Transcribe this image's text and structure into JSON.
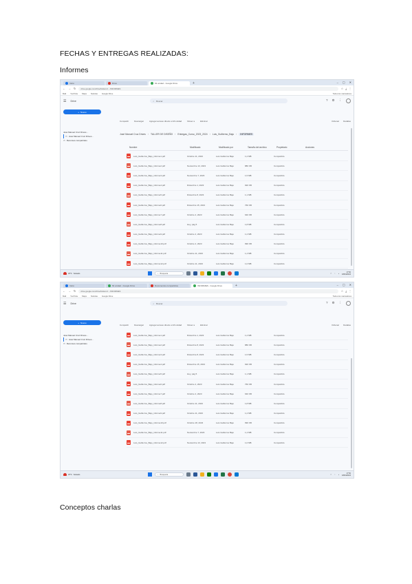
{
  "document": {
    "heading_fechas": "FECHAS Y ENTREGAS REALIZADAS:",
    "heading_informes": "Informes",
    "heading_conceptos": "Conceptos charlas"
  },
  "colors": {
    "accent": "#1a73e8",
    "pdf_red": "#e94335",
    "taskbar": "#e9eef5"
  },
  "screenshot_1": {
    "tabs": [
      "Inicio",
      "Drive",
      "Mi unidad - Google Drive"
    ],
    "url": "drive.google.com/drive/folders/1…/INFORMES",
    "bookmarks": [
      "Mail",
      "YouTube",
      "Maps",
      "Noticias",
      "Google Drive"
    ],
    "bookmarks_right": "Todos los marcadores",
    "drive_logo": "Drive",
    "search_placeholder": "Buscar",
    "new_button": "Nuevo",
    "side_items": [
      "José Manuel Cruz Drives…",
      "José Manuel Cruz Drives…",
      "Recursos compartidos"
    ],
    "toolbar": [
      "Compartir",
      "Descargar",
      "Agregar acceso directo a Mi unidad",
      "Mover a",
      "Eliminar"
    ],
    "toolbar_right": [
      "Ordenar",
      "Detalles"
    ],
    "breadcrumbs": [
      "José Manuel Cruz Drives",
      "TALLER DE DISEÑO",
      "Entregas_Curso_2023_2024",
      "Luis_Guillermo_Bajo",
      "INFORMES"
    ],
    "columns": [
      "Nombre",
      "Modificado",
      "Modificado por",
      "Tamaño del archivo",
      "Propietario",
      "Acciones"
    ],
    "rows": [
      {
        "name": "Luis_Guillermo_Bajo_informe1.pdf",
        "modified": "Octubre 11, 2023",
        "by": "Luis Guillermo Bajo",
        "size": "1,2 MB",
        "share": "Compartido"
      },
      {
        "name": "Luis_Guillermo_Bajo_informe2.pdf",
        "modified": "Noviembre 13, 2023",
        "by": "Luis Guillermo Bajo",
        "size": "880 KB",
        "share": "Compartido"
      },
      {
        "name": "Luis_Guillermo_Bajo_informe3.pdf",
        "modified": "Noviembre 7, 2023",
        "by": "Luis Guillermo Bajo",
        "size": "1,5 MB",
        "share": "Compartido"
      },
      {
        "name": "Luis_Guillermo_Bajo_informe4.pdf",
        "modified": "Diciembre 1, 2023",
        "by": "Luis Guillermo Bajo",
        "size": "920 KB",
        "share": "Compartido"
      },
      {
        "name": "Luis_Guillermo_Bajo_informe5.pdf",
        "modified": "Diciembre 8, 2023",
        "by": "Luis Guillermo Bajo",
        "size": "1,1 MB",
        "share": "Compartido"
      },
      {
        "name": "Luis_Guillermo_Bajo_informe6.pdf",
        "modified": "Diciembre 15, 2023",
        "by": "Luis Guillermo Bajo",
        "size": "760 KB",
        "share": "Compartido"
      },
      {
        "name": "Luis_Guillermo_Bajo_informe7.pdf",
        "modified": "Octubre 4, 2023",
        "by": "Luis Guillermo Bajo",
        "size": "640 KB",
        "share": "Compartido"
      },
      {
        "name": "Luis_Guillermo_Bajo_informe8.pdf",
        "modified": "Hoy, pág 5",
        "by": "Luis Guillermo Bajo",
        "size": "1,8 MB",
        "share": "Compartido"
      },
      {
        "name": "Luis_Guillermo_Bajo_informe9.pdf",
        "modified": "Octubre 4, 2023",
        "by": "Luis Guillermo Bajo",
        "size": "1,2 MB",
        "share": "Compartido"
      },
      {
        "name": "Luis_Guillermo_Bajo_informe10.pdf",
        "modified": "Octubre 4, 2023",
        "by": "Luis Guillermo Bajo",
        "size": "990 KB",
        "share": "Compartido"
      },
      {
        "name": "Luis_Guillermo_Bajo_informe11.pdf",
        "modified": "Octubre 11, 2023",
        "by": "Luis Guillermo Bajo",
        "size": "1,4 MB",
        "share": "Compartido"
      },
      {
        "name": "Luis_Guillermo_Bajo_informe12.pdf",
        "modified": "Octubre 11, 2023",
        "by": "Luis Guillermo Bajo",
        "size": "1,0 MB",
        "share": "Compartido"
      }
    ],
    "taskbar": {
      "weather": "25°C",
      "weather_sub": "Soleado",
      "search": "Búsqueda",
      "time": "17:52",
      "date": "18/04/2024"
    }
  },
  "screenshot_2": {
    "tabs": [
      "Inicio",
      "Mi unidad - Google Drive",
      "Documentos compartidos",
      "INFORMES - Google Drive"
    ],
    "url": "drive.google.com/drive/folders/1…/INFORMES",
    "bookmarks": [
      "Mail",
      "YouTube",
      "Maps",
      "Noticias",
      "Google Drive"
    ],
    "bookmarks_right": "Todos los marcadores",
    "drive_logo": "Drive",
    "search_placeholder": "Buscar",
    "new_button": "Nuevo",
    "side_items": [
      "José Manuel Cruz Drives…",
      "José Manuel Cruz Drives…",
      "Recursos compartidos"
    ],
    "toolbar": [
      "Compartir",
      "Descargar",
      "Agregar acceso directo a Mi unidad",
      "Mover a",
      "Eliminar"
    ],
    "toolbar_right": [
      "Ordenar",
      "Detalles"
    ],
    "rows": [
      {
        "name": "Luis_Guillermo_Bajo_informe1.pdf",
        "modified": "Diciembre 1, 2023",
        "by": "Luis Guillermo Bajo",
        "size": "1,2 MB",
        "share": "Compartido"
      },
      {
        "name": "Luis_Guillermo_Bajo_informe2.pdf",
        "modified": "Diciembre 8, 2023",
        "by": "Luis Guillermo Bajo",
        "size": "880 KB",
        "share": "Compartido"
      },
      {
        "name": "Luis_Guillermo_Bajo_informe3.pdf",
        "modified": "Diciembre 8, 2023",
        "by": "Luis Guillermo Bajo",
        "size": "1,5 MB",
        "share": "Compartido"
      },
      {
        "name": "Luis_Guillermo_Bajo_informe4.pdf",
        "modified": "Diciembre 15, 2023",
        "by": "Luis Guillermo Bajo",
        "size": "920 KB",
        "share": "Compartido"
      },
      {
        "name": "Luis_Guillermo_Bajo_informe5.pdf",
        "modified": "Hoy, pág 5",
        "by": "Luis Guillermo Bajo",
        "size": "1,1 MB",
        "share": "Compartido"
      },
      {
        "name": "Luis_Guillermo_Bajo_informe6.pdf",
        "modified": "Octubre 4, 2023",
        "by": "Luis Guillermo Bajo",
        "size": "760 KB",
        "share": "Compartido"
      },
      {
        "name": "Luis_Guillermo_Bajo_informe7.pdf",
        "modified": "Octubre 4, 2023",
        "by": "Luis Guillermo Bajo",
        "size": "640 KB",
        "share": "Compartido"
      },
      {
        "name": "Luis_Guillermo_Bajo_informe8.pdf",
        "modified": "Octubre 11, 2023",
        "by": "Luis Guillermo Bajo",
        "size": "1,8 MB",
        "share": "Compartido"
      },
      {
        "name": "Luis_Guillermo_Bajo_informe9.pdf",
        "modified": "Octubre 11, 2023",
        "by": "Luis Guillermo Bajo",
        "size": "1,2 MB",
        "share": "Compartido"
      },
      {
        "name": "Luis_Guillermo_Bajo_informe10.pdf",
        "modified": "Octubre 18, 2023",
        "by": "Luis Guillermo Bajo",
        "size": "990 KB",
        "share": "Compartido"
      },
      {
        "name": "Luis_Guillermo_Bajo_informe11.pdf",
        "modified": "Noviembre 7, 2023",
        "by": "Luis Guillermo Bajo",
        "size": "1,4 MB",
        "share": "Compartido"
      },
      {
        "name": "Luis_Guillermo_Bajo_informe12.pdf",
        "modified": "Noviembre 13, 2023",
        "by": "Luis Guillermo Bajo",
        "size": "1,0 MB",
        "share": "Compartido"
      }
    ],
    "taskbar": {
      "weather": "25°C",
      "weather_sub": "Soleado",
      "search": "Búsqueda",
      "time": "17:52",
      "date": "18/04/2024"
    }
  }
}
